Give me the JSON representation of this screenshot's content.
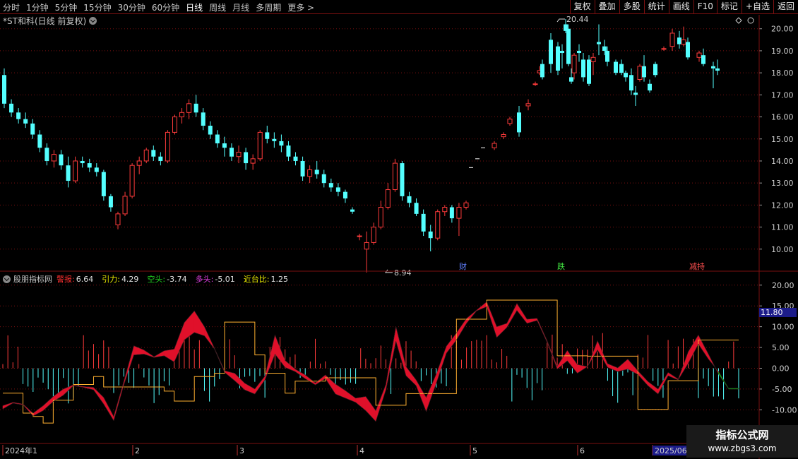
{
  "toolbar": {
    "periods": [
      "分时",
      "1分钟",
      "5分钟",
      "15分钟",
      "30分钟",
      "60分钟",
      "日线",
      "周线",
      "月线",
      "多周期",
      "更多 >"
    ],
    "active_period": "日线",
    "right_buttons": [
      "复权",
      "叠加",
      "多股",
      "统计",
      "画线",
      "F10",
      "标记",
      "+自选",
      "返回"
    ]
  },
  "chart_title": "*ST和科(日线 前复权)",
  "price_axis": {
    "ticks": [
      "20.00",
      "19.00",
      "18.00",
      "17.00",
      "16.00",
      "15.00",
      "14.00",
      "13.00",
      "12.00",
      "11.00",
      "10.00"
    ]
  },
  "price_annotations": {
    "high": "20.44",
    "low": "8.94"
  },
  "event_markers": [
    "财",
    "跌",
    "减持"
  ],
  "indicator": {
    "name": "股朋指标网",
    "items": [
      {
        "label": "警报:",
        "value": "6.64",
        "color": "#ff3030"
      },
      {
        "label": "引力:",
        "value": "4.29",
        "color": "#e8e800"
      },
      {
        "label": "空头:",
        "value": "-3.74",
        "color": "#20d020"
      },
      {
        "label": "多头:",
        "value": "-5.01",
        "color": "#e040e0"
      },
      {
        "label": "近台比:",
        "value": "1.25",
        "color": "#e8e800"
      }
    ],
    "axis_ticks": [
      "20.00",
      "15.00",
      "10.00",
      "5.00",
      "0.00",
      "-5.00",
      "-10.00"
    ],
    "badge": "11.80"
  },
  "date_axis": [
    "2024年1",
    "2",
    "3",
    "4",
    "5",
    "6",
    "2025/06"
  ],
  "watermark": {
    "line1": "指标公式网",
    "line2": "www.zbgs3.com"
  },
  "colors": {
    "up": "#ff3b3b",
    "down": "#54ffff",
    "grid": "#7a1010",
    "band_green": "#10c010",
    "band_red": "#e0102a",
    "line_orange": "#ffb030"
  },
  "chart_data": [
    {
      "type": "candlestick",
      "title": "*ST和科(日线 前复权)",
      "ylim": [
        9.0,
        20.6
      ],
      "x": [
        "2024年1",
        "2",
        "3",
        "4",
        "5",
        "6",
        "2025/06"
      ],
      "candles": [
        [
          17.9,
          18.2,
          16.4,
          16.6
        ],
        [
          16.6,
          16.8,
          16.0,
          16.2
        ],
        [
          16.2,
          16.4,
          15.7,
          15.9
        ],
        [
          15.9,
          16.2,
          15.5,
          15.7
        ],
        [
          15.7,
          15.9,
          15.0,
          15.2
        ],
        [
          15.2,
          15.4,
          14.4,
          14.6
        ],
        [
          14.6,
          14.8,
          13.8,
          14.0
        ],
        [
          14.0,
          14.5,
          13.7,
          14.3
        ],
        [
          14.3,
          14.5,
          13.6,
          13.8
        ],
        [
          13.8,
          14.2,
          12.8,
          13.1
        ],
        [
          13.1,
          14.2,
          13.0,
          14.0
        ],
        [
          14.0,
          14.2,
          13.7,
          13.9
        ],
        [
          13.9,
          14.1,
          13.5,
          13.7
        ],
        [
          13.7,
          13.9,
          13.3,
          13.5
        ],
        [
          13.5,
          13.6,
          12.2,
          12.4
        ],
        [
          12.4,
          12.5,
          11.7,
          11.9
        ],
        [
          11.1,
          11.7,
          10.9,
          11.6
        ],
        [
          11.6,
          12.6,
          11.5,
          12.4
        ],
        [
          12.4,
          13.9,
          12.3,
          13.8
        ],
        [
          13.8,
          14.2,
          13.4,
          14.0
        ],
        [
          14.0,
          14.6,
          13.9,
          14.5
        ],
        [
          14.5,
          14.7,
          14.0,
          14.2
        ],
        [
          14.2,
          14.4,
          13.8,
          14.0
        ],
        [
          14.0,
          15.4,
          13.9,
          15.3
        ],
        [
          15.3,
          16.1,
          15.2,
          16.0
        ],
        [
          16.0,
          16.4,
          15.7,
          16.2
        ],
        [
          16.2,
          16.8,
          15.9,
          16.6
        ],
        [
          16.6,
          17.0,
          16.0,
          16.2
        ],
        [
          16.2,
          16.4,
          15.4,
          15.6
        ],
        [
          15.6,
          15.8,
          15.0,
          15.2
        ],
        [
          15.2,
          15.4,
          14.6,
          14.8
        ],
        [
          14.8,
          15.1,
          14.2,
          14.6
        ],
        [
          14.6,
          14.8,
          14.0,
          14.2
        ],
        [
          14.2,
          14.7,
          13.9,
          14.4
        ],
        [
          14.4,
          14.6,
          13.6,
          13.9
        ],
        [
          13.9,
          14.3,
          13.6,
          14.1
        ],
        [
          14.1,
          15.4,
          14.0,
          15.3
        ],
        [
          15.3,
          15.6,
          14.8,
          15.0
        ],
        [
          15.0,
          15.3,
          14.6,
          14.9
        ],
        [
          14.9,
          15.2,
          14.4,
          14.7
        ],
        [
          14.7,
          14.9,
          14.0,
          14.2
        ],
        [
          14.2,
          14.4,
          13.8,
          14.0
        ],
        [
          14.0,
          14.2,
          13.1,
          13.3
        ],
        [
          13.3,
          13.8,
          13.0,
          13.6
        ],
        [
          13.6,
          14.0,
          13.2,
          13.4
        ],
        [
          13.4,
          13.6,
          12.8,
          13.0
        ],
        [
          13.0,
          13.2,
          12.6,
          12.8
        ],
        [
          12.8,
          13.0,
          12.4,
          12.6
        ],
        [
          12.6,
          12.7,
          12.1,
          12.3
        ],
        [
          11.8,
          11.9,
          11.6,
          11.7
        ],
        [
          10.6,
          10.7,
          10.4,
          10.6
        ],
        [
          10.0,
          10.8,
          8.94,
          10.3
        ],
        [
          10.3,
          11.2,
          10.2,
          11.0
        ],
        [
          11.0,
          12.2,
          10.9,
          11.9
        ],
        [
          11.9,
          13.0,
          11.8,
          12.7
        ],
        [
          12.7,
          14.1,
          12.6,
          13.9
        ],
        [
          13.9,
          14.0,
          12.2,
          12.4
        ],
        [
          12.4,
          12.6,
          11.9,
          12.1
        ],
        [
          12.1,
          12.3,
          11.5,
          11.6
        ],
        [
          11.6,
          11.8,
          10.6,
          10.8
        ],
        [
          10.8,
          11.1,
          9.9,
          10.5
        ],
        [
          10.5,
          11.8,
          10.4,
          11.7
        ],
        [
          11.7,
          12.0,
          11.5,
          11.9
        ],
        [
          11.9,
          12.0,
          11.2,
          11.4
        ],
        [
          11.4,
          12.1,
          10.6,
          11.9
        ],
        [
          11.9,
          12.2,
          11.8,
          12.1
        ]
      ]
    },
    {
      "type": "area",
      "title": "股朋指标网",
      "ylim": [
        -13.0,
        22.0
      ],
      "series": [
        {
          "name": "空头",
          "values": [
            -9.8,
            -8.4,
            -8.8,
            -11.5,
            -10.2,
            -8.0,
            -6.5,
            -4.2,
            -4.6,
            -5.2,
            -8.6,
            -12.6,
            -4.0,
            3.2,
            3.4,
            2.6,
            3.0,
            1.5,
            6.8,
            8.6,
            7.8,
            4.6,
            -1.0,
            -3.0,
            -5.2,
            -6.2,
            -2.8,
            3.4,
            0.2,
            -0.8,
            -2.5,
            -4.0,
            -2.5,
            -6.2,
            -7.2,
            -8.2,
            -10.2,
            -12.8,
            -5.2,
            6.5,
            -1.8,
            -4.2,
            -10.4,
            -3.6,
            3.6,
            6.8,
            10.8,
            13.8,
            14.8,
            7.4,
            9.8,
            13.9,
            10.8,
            11.5,
            6.2,
            -0.2,
            1.8,
            -1.2,
            0.4,
            4.4,
            0.2,
            -0.8,
            -0.2,
            -1.5,
            -4.2,
            -6.2,
            -1.8,
            -2.8,
            1.2,
            5.8,
            2.2,
            -0.8,
            -4.8,
            -4.8
          ]
        },
        {
          "name": "多头",
          "values": [
            -9.0,
            -8.2,
            -8.6,
            -10.8,
            -9.0,
            -6.8,
            -5.0,
            -4.0,
            -4.4,
            -4.6,
            -7.0,
            -11.6,
            -3.2,
            5.4,
            4.4,
            2.8,
            4.2,
            4.6,
            11.0,
            13.8,
            10.0,
            4.8,
            -0.6,
            -1.2,
            -3.6,
            -5.0,
            -1.9,
            8.0,
            1.9,
            -0.2,
            -1.6,
            -3.5,
            -1.6,
            -3.8,
            -5.4,
            -7.2,
            -6.8,
            -10.2,
            -3.9,
            10.0,
            0.4,
            -2.8,
            -7.0,
            -1.4,
            5.3,
            8.5,
            12.0,
            14.0,
            16.0,
            10.0,
            10.8,
            15.6,
            11.8,
            12.0,
            6.6,
            0.5,
            4.3,
            0.9,
            0.4,
            6.6,
            1.1,
            0.1,
            2.2,
            -0.6,
            -3.2,
            -5.0,
            -1.0,
            -2.6,
            4.0,
            8.0,
            3.4,
            -1.4,
            -5.0,
            -5.0
          ]
        },
        {
          "name": "引力",
          "values": [
            -6.0,
            -6.0,
            -10.8,
            -11.6,
            -13.2,
            -7.7,
            -7.7,
            -3.9,
            -3.9,
            -2.0,
            -4.5,
            -4.5,
            -4.5,
            -4.5,
            -4.5,
            -4.5,
            -5.5,
            -7.9,
            -7.9,
            -2.0,
            -2.0,
            -1.2,
            11.1,
            11.1,
            11.1,
            3.2,
            -1.2,
            -1.2,
            -6.0,
            -3.1,
            -3.1,
            -3.1,
            -2.3,
            -2.3,
            -2.3,
            -2.3,
            -2.3,
            -8.9,
            -8.9,
            -8.9,
            -6.1,
            -6.1,
            -6.1,
            -6.1,
            -6.1,
            11.8,
            11.8,
            11.8,
            16.4,
            16.4,
            16.4,
            16.4,
            16.4,
            16.4,
            16.4,
            3.0,
            3.0,
            3.0,
            2.9,
            2.9,
            2.9,
            2.9,
            2.9,
            -9.9,
            -9.9,
            -9.9,
            -3.0,
            -3.0,
            -3.0,
            6.8,
            6.8,
            6.8,
            6.8,
            6.8
          ]
        }
      ]
    }
  ]
}
